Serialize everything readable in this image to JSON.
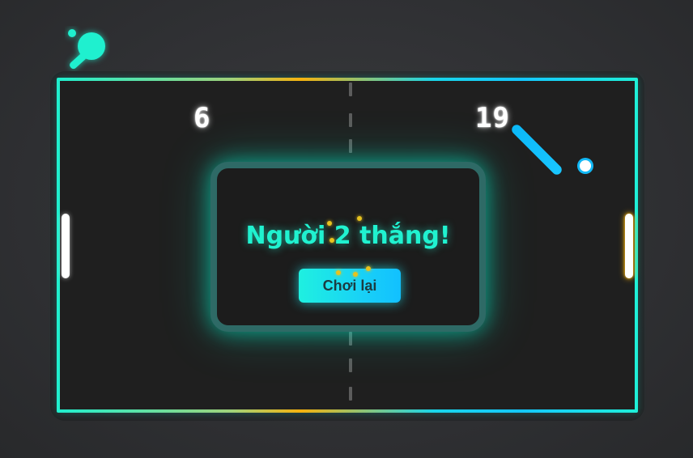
{
  "logo": {
    "icon": "ping-pong-paddle-icon",
    "color": "#1ff0cf"
  },
  "scoreboard": {
    "player1_score": "6",
    "player2_score": "19"
  },
  "modal": {
    "title": "Người 2 thắng!",
    "replay_label": "Chơi lại"
  },
  "colors": {
    "accent_cyan": "#1ff0cf",
    "accent_blue": "#12c0ff",
    "accent_gold": "#f5b20e",
    "board_background": "#1f1f1f",
    "page_background": "#2f3033"
  }
}
